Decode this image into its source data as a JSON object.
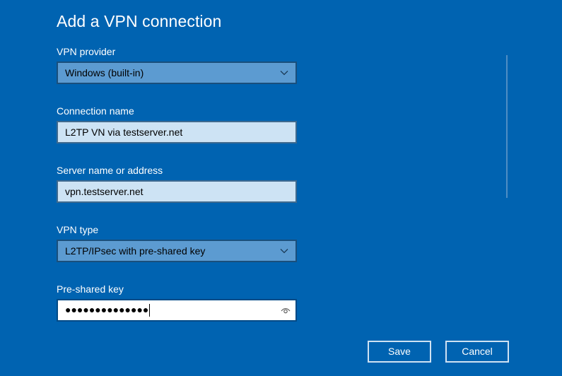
{
  "dialog": {
    "title": "Add a VPN connection"
  },
  "fields": {
    "vpn_provider": {
      "label": "VPN provider",
      "value": "Windows (built-in)"
    },
    "connection_name": {
      "label": "Connection name",
      "value": "L2TP VN via testserver.net"
    },
    "server_name": {
      "label": "Server name or address",
      "value": "vpn.testserver.net"
    },
    "vpn_type": {
      "label": "VPN type",
      "value": "L2TP/IPsec with pre-shared key"
    },
    "pre_shared_key": {
      "label": "Pre-shared key",
      "masked_value": "●●●●●●●●●●●●●●",
      "reveal_icon": "eye-icon"
    }
  },
  "buttons": {
    "save": "Save",
    "cancel": "Cancel"
  },
  "colors": {
    "background": "#0063b1",
    "select_fill": "#5c9bd1",
    "input_fill": "#cde3f4",
    "focused_input_fill": "#ffffff",
    "button_border": "#cfe2f3"
  }
}
